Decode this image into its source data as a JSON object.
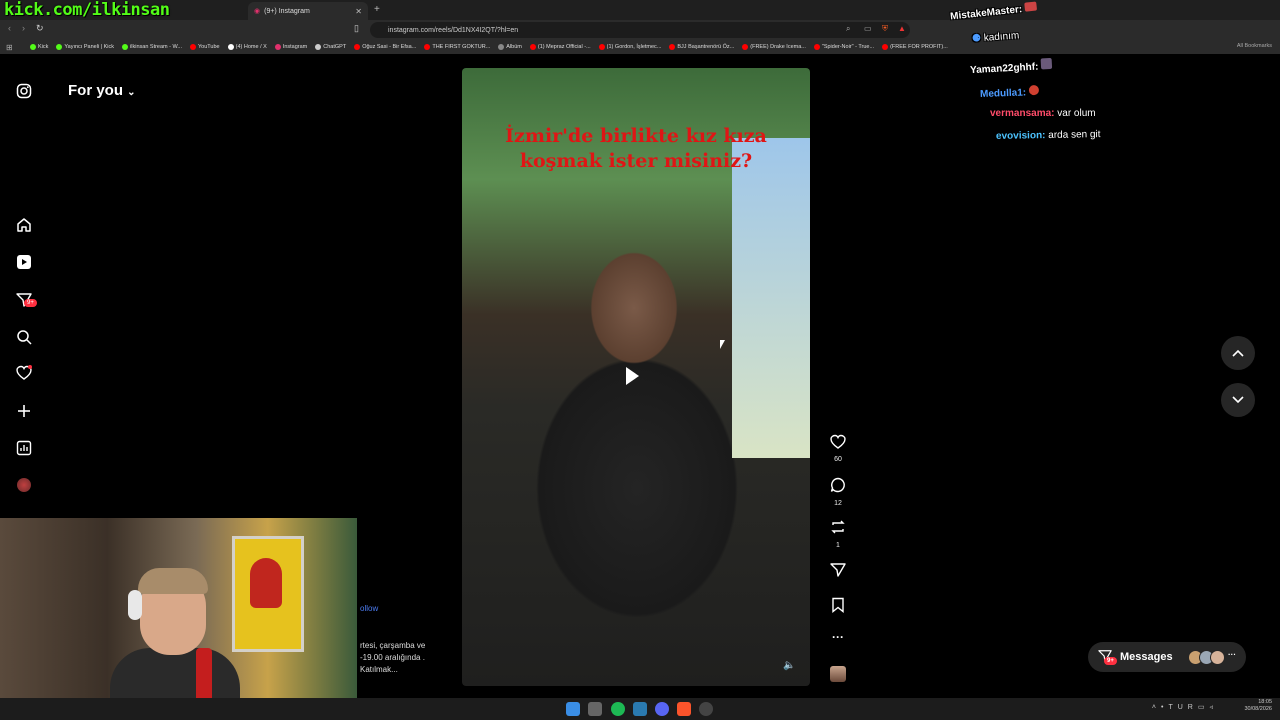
{
  "stream": {
    "channel_url": "kick.com/ilkinsan"
  },
  "browser": {
    "tab_title": "(9+) Instagram",
    "new_tab": "+",
    "url": "instagram.com/reels/Dd1NX4I2QT/?hl=en",
    "bookmarks": [
      {
        "label": "Kick",
        "color": "#53fc18"
      },
      {
        "label": "Yayıncı Paneli | Kick",
        "color": "#53fc18"
      },
      {
        "label": "ilkinsan Stream - W...",
        "color": "#53fc18"
      },
      {
        "label": "YouTube",
        "color": "#ff0000"
      },
      {
        "label": "(4) Home / X",
        "color": "#ffffff"
      },
      {
        "label": "Instagram",
        "color": "#e1306c"
      },
      {
        "label": "ChatGPT",
        "color": "#cccccc"
      },
      {
        "label": "Oğuz Sasi - Bir Efsa...",
        "color": "#ff0000"
      },
      {
        "label": "THE FIRST GOKTUR...",
        "color": "#ff0000"
      },
      {
        "label": "Albüm",
        "color": "#888888"
      },
      {
        "label": "(1) Mepraz Official -...",
        "color": "#ff0000"
      },
      {
        "label": "(1) Gordon, İşletmec...",
        "color": "#ff0000"
      },
      {
        "label": "BJJ Başantrenörü Öz...",
        "color": "#ff0000"
      },
      {
        "label": "(FREE) Drake Icema...",
        "color": "#ff0000"
      },
      {
        "label": "\"Spider-Noir\" - True...",
        "color": "#ff0000"
      },
      {
        "label": "(FREE FOR PROFIT)...",
        "color": "#ff0000"
      }
    ],
    "all_bookmarks": "All Bookmarks"
  },
  "instagram": {
    "feed_label": "For you",
    "notifications_badge": "9+",
    "video": {
      "overlay_text": "İzmir'de birlikte kız kıza koşmak ister misiniz?"
    },
    "actions": {
      "likes": "60",
      "comments": "12",
      "reposts": "1"
    },
    "caption": {
      "follow": "ollow",
      "text": "rtesi, çarşamba ve -19.00 aralığında . Katılmak..."
    },
    "messages_label": "Messages",
    "messages_badge": "9+"
  },
  "chat": [
    {
      "user": "MistakeMaster:",
      "message": "",
      "color": "#ffffff"
    },
    {
      "user": "",
      "message": "kadınım",
      "color": "#4c9bff"
    },
    {
      "user": "Yaman22ghhf:",
      "message": "",
      "color": "#ffffff"
    },
    {
      "user": "Medulla1:",
      "message": "",
      "color": "#4c9bff"
    },
    {
      "user": "vermansama:",
      "message": "var olum",
      "color": "#ff4c6a"
    },
    {
      "user": "evovision:",
      "message": "arda sen git",
      "color": "#4cc3ff"
    }
  ],
  "taskbar": {
    "lang": "TUR",
    "time": "18:05",
    "date": "30/08/2026"
  },
  "colors": {
    "accent_red": "#ff3040",
    "kick_green": "#53fc18",
    "ig_bg": "#000000"
  }
}
